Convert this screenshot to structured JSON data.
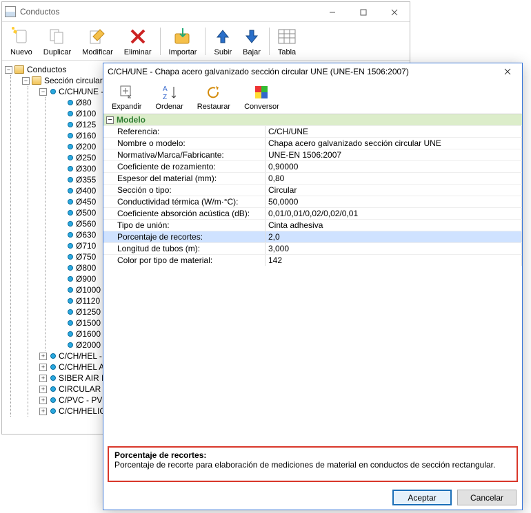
{
  "back_window": {
    "title": "Conductos",
    "toolbar": {
      "nuevo": "Nuevo",
      "duplicar": "Duplicar",
      "modificar": "Modificar",
      "eliminar": "Eliminar",
      "importar": "Importar",
      "subir": "Subir",
      "bajar": "Bajar",
      "tabla": "Tabla"
    },
    "tree": {
      "root": "Conductos",
      "branch": "Sección circular",
      "cchune": "C/CH/UNE -",
      "sizes": [
        "Ø80",
        "Ø100",
        "Ø125",
        "Ø160",
        "Ø200",
        "Ø250",
        "Ø300",
        "Ø355",
        "Ø400",
        "Ø450",
        "Ø500",
        "Ø560",
        "Ø630",
        "Ø710",
        "Ø750",
        "Ø800",
        "Ø900",
        "Ø1000",
        "Ø1120",
        "Ø1250",
        "Ø1500",
        "Ø1600",
        "Ø2000"
      ],
      "siblings": [
        "C/CH/HEL -",
        "C/CH/HEL A",
        "SIBER AIR I",
        "CIRCULAR F",
        "C/PVC - PVC",
        "C/CH/HELIC"
      ]
    }
  },
  "front_window": {
    "title": "C/CH/UNE - Chapa acero galvanizado sección circular UNE (UNE-EN 1506:2007)",
    "toolbar": {
      "expandir": "Expandir",
      "ordenar": "Ordenar",
      "restaurar": "Restaurar",
      "conversor": "Conversor"
    },
    "group": "Modelo",
    "props": {
      "referencia_k": "Referencia:",
      "referencia_v": "C/CH/UNE",
      "nombre_k": "Nombre o modelo:",
      "nombre_v": "Chapa acero galvanizado sección circular UNE",
      "normativa_k": "Normativa/Marca/Fabricante:",
      "normativa_v": "UNE-EN 1506:2007",
      "coef_roz_k": "Coeficiente de rozamiento:",
      "coef_roz_v": "0,90000",
      "espesor_k": "Espesor del material (mm):",
      "espesor_v": "0,80",
      "seccion_k": "Sección o tipo:",
      "seccion_v": "Circular",
      "cond_k": "Conductividad térmica (W/m·°C):",
      "cond_v": "50,0000",
      "coef_abs_k": "Coeficiente absorción acústica (dB):",
      "coef_abs_v": "0,01/0,01/0,02/0,02/0,01",
      "union_k": "Tipo de unión:",
      "union_v": "Cinta adhesiva",
      "recortes_k": "Porcentaje de recortes:",
      "recortes_v": "2,0",
      "longitud_k": "Longitud de tubos (m):",
      "longitud_v": "3,000",
      "color_k": "Color por tipo de material:",
      "color_v": "142"
    },
    "desc": {
      "title": "Porcentaje de recortes:",
      "text": "Porcentaje de recorte para elaboración de mediciones de material en conductos de sección rectangular."
    },
    "buttons": {
      "ok": "Aceptar",
      "cancel": "Cancelar"
    }
  }
}
